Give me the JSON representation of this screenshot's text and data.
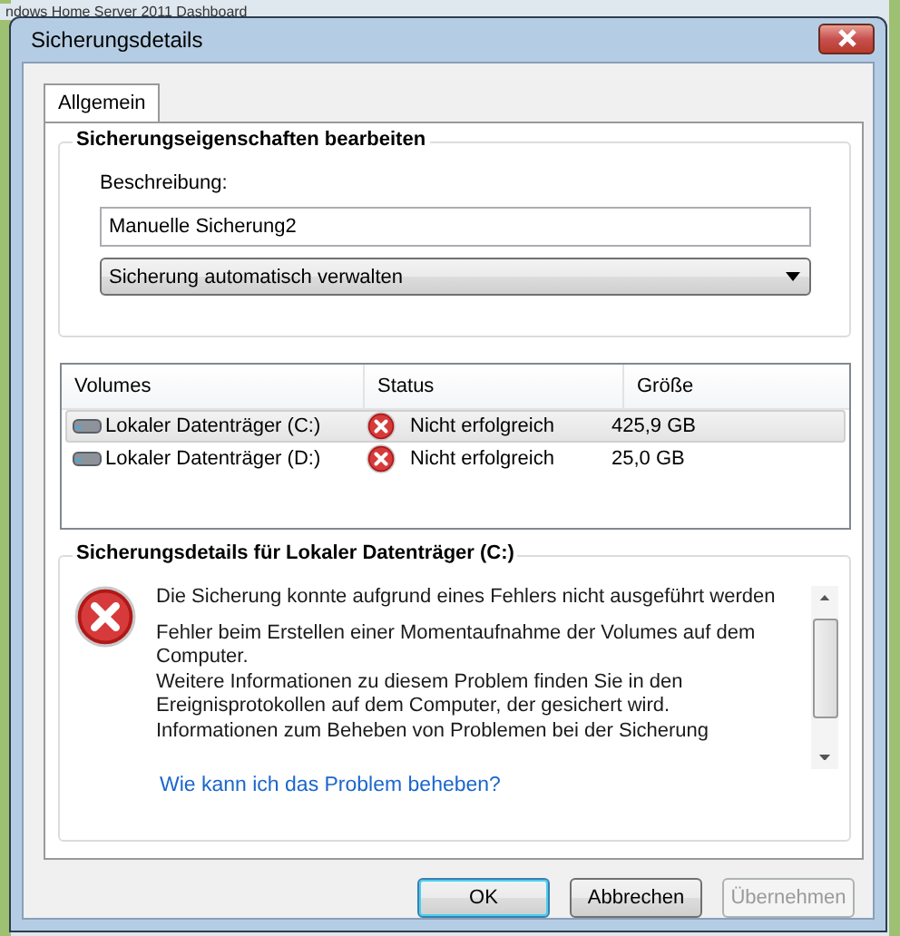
{
  "background_window": {
    "title": "ndows Home Server 2011  Dashboard"
  },
  "window": {
    "title": "Sicherungsdetails"
  },
  "tabs": [
    {
      "label": "Allgemein",
      "selected": true
    }
  ],
  "properties": {
    "title": "Sicherungseigenschaften bearbeiten",
    "description_label": "Beschreibung:",
    "description_value": "Manuelle Sicherung2",
    "dropdown_value": "Sicherung automatisch verwalten"
  },
  "volumes": {
    "columns": [
      "Volumes",
      "Status",
      "Größe"
    ],
    "rows": [
      {
        "name": "Lokaler Datenträger (C:)",
        "kind": "error",
        "status": "Nicht erfolgreich",
        "size": "425,9 GB",
        "selected": true
      },
      {
        "name": "Lokaler Datenträger (D:)",
        "kind": "error",
        "status": "Nicht erfolgreich",
        "size": "25,0 GB",
        "selected": false
      }
    ]
  },
  "details": {
    "title": "Sicherungsdetails für Lokaler Datenträger (C:)",
    "kind": "error",
    "heading": "Die Sicherung konnte aufgrund eines Fehlers nicht ausgeführt werden",
    "paragraph": "Fehler beim Erstellen einer Momentaufnahme der Volumes auf dem Computer.\nWeitere Informationen zu diesem Problem finden Sie in den Ereignisprotokollen auf dem Computer, der gesichert wird.\nInformationen zum Beheben von Problemen bei der Sicherung",
    "link": "Wie kann ich das Problem beheben?"
  },
  "buttons": [
    {
      "label": "OK",
      "kind": "default",
      "disabled": false
    },
    {
      "label": "Abbrechen",
      "kind": "normal",
      "disabled": false
    },
    {
      "label": "Übernehmen",
      "kind": "normal",
      "disabled": true
    }
  ]
}
